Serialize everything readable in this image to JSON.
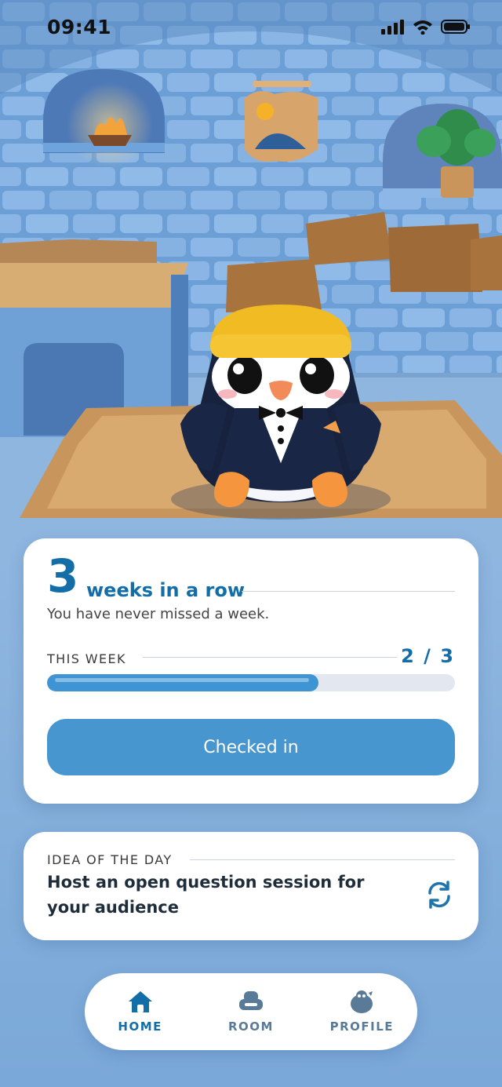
{
  "status_bar": {
    "time": "09:41"
  },
  "streak": {
    "count": "3",
    "label": "weeks in a row",
    "subtitle": "You have never missed a week."
  },
  "this_week": {
    "label": "THIS WEEK",
    "count_text": "2 / 3",
    "progress": 0.666
  },
  "checkin_button": {
    "label": "Checked in"
  },
  "idea": {
    "label": "IDEA OF THE DAY",
    "text": "Host an open question session for your audience",
    "refresh_icon": "refresh-icon"
  },
  "nav": {
    "items": [
      {
        "label": "HOME",
        "icon": "home-icon",
        "active": true
      },
      {
        "label": "ROOM",
        "icon": "armchair-icon",
        "active": false
      },
      {
        "label": "PROFILE",
        "icon": "penguin-icon",
        "active": false
      }
    ]
  },
  "colors": {
    "accent": "#136ea8",
    "button": "#4796cf",
    "progress_fill": "#3f94d3",
    "track": "#e3e8f0"
  }
}
